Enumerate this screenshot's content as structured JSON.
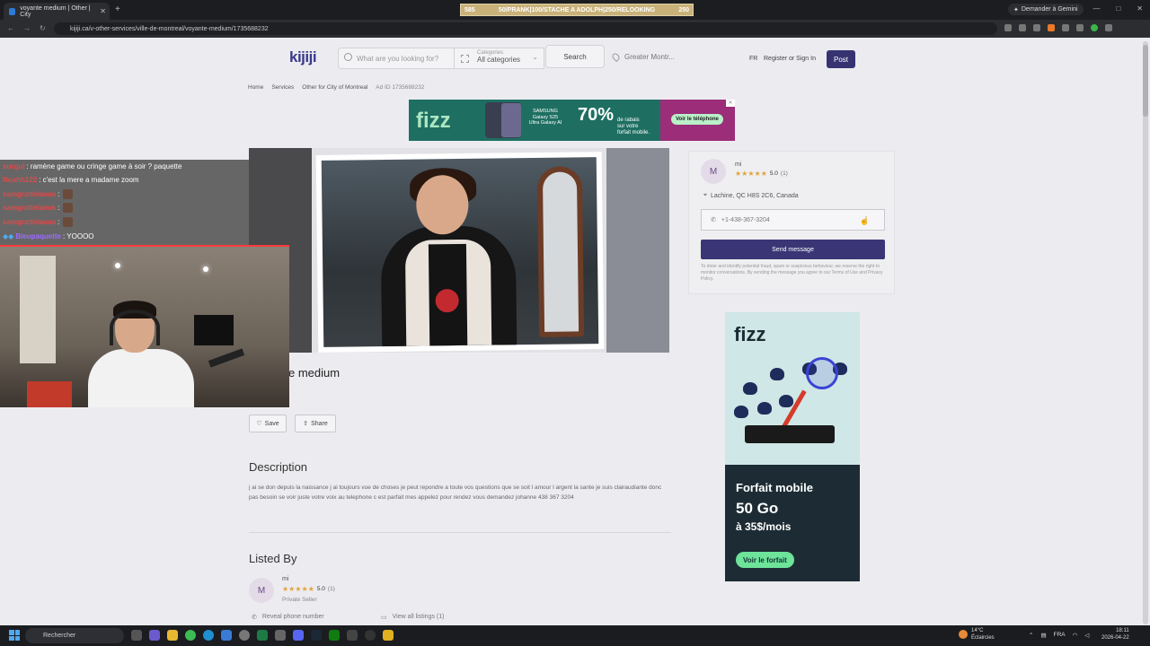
{
  "browser": {
    "tab_title": "voyante medium | Other | City",
    "tab_close": "✕",
    "new_tab": "+",
    "overlay_banner_left": "585",
    "overlay_banner": "50/PRANK|100/STACHE A ADOLPH|250/RELOOKING",
    "overlay_banner_right": "250",
    "gemini_label": "Demander à Gemini",
    "window_controls": [
      "—",
      "□",
      "✕"
    ],
    "url": "kijiji.ca/v-other-services/ville-de-montreal/voyante-medium/1735688232"
  },
  "header": {
    "logo": "kijiji",
    "search_placeholder": "What are you looking for?",
    "category_label": "Categories",
    "category_value": "All categories",
    "search_button": "Search",
    "location": "Greater Montr...",
    "language": "FR",
    "register": "Register or Sign In",
    "post": "Post"
  },
  "breadcrumb": [
    "Home",
    "Services",
    "Other for City of Montreal",
    "Ad ID 1735688232"
  ],
  "ad_top": {
    "brand": "fizz",
    "product": "SAMSUNG Galaxy S25 Ultra Galaxy AI",
    "percent": "70%",
    "sub1": "de rabais",
    "sub2": "sur votre",
    "sub3": "forfait mobile.",
    "cta": "Voir le téléphone"
  },
  "listing": {
    "title": "e medium",
    "save": "Save",
    "share": "Share",
    "description_heading": "Description",
    "description": "j ai se don depuis la naissance j ai toujours vue de choses je peut repondre a toute vos questions que se soit l amour l argent la sante je suis clairaudiante donc pas besoin se voir juste votre voix au telephone c est parfait mes appelez pour rendez vous demandez johanne 438 367 3204",
    "listed_by_heading": "Listed By",
    "reveal_phone": "Reveal phone number",
    "view_all": "View all listings (1)"
  },
  "seller": {
    "initial": "M",
    "name": "mi",
    "stars": "★★★★★",
    "rating": "5.0",
    "count": "(1)",
    "type": "Private Seller",
    "location": "Lachine, QC H8S 2C6, Canada",
    "phone": "+1-438-367-3204",
    "send": "Send message",
    "disclaimer": "To deter and identify potential fraud, spam or suspicious behaviour, we reserve the right to monitor conversations. By sending the message you agree to our Terms of Use and Privacy Policy."
  },
  "ad_side": {
    "brand": "fizz",
    "line1": "Forfait mobile",
    "line2": "50 Go",
    "line3": "à 35$/mois",
    "cta": "Voir le forfait"
  },
  "chat": [
    {
      "user": "surgul",
      "text": ": ramène game ou cringe game à soir ? paquette"
    },
    {
      "user": "Noahh122",
      "text": ": c'est la mere a madame zoom"
    },
    {
      "user": "samgrattelanus",
      "text": ":"
    },
    {
      "user": "samgrattelanus",
      "text": ":"
    },
    {
      "user": "samgrattelanus",
      "text": ":"
    },
    {
      "user": "Bleupaquette",
      "text": ": YOOOO"
    }
  ],
  "taskbar": {
    "search": "Rechercher",
    "weather_temp": "14°C",
    "weather_desc": "Éclaircies",
    "lang": "FRA",
    "time": "18:11",
    "date": "2026-04-22"
  },
  "colors": {
    "kijiji_purple": "#373373",
    "fizz_green": "#1e6f62",
    "star": "#e1a43a"
  }
}
